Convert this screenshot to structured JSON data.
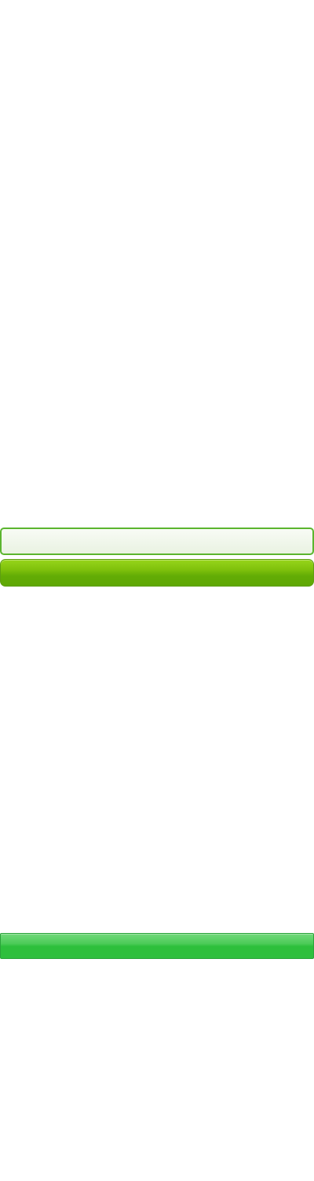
{
  "form": {
    "input_value": "",
    "input_placeholder": "",
    "submit_label": ""
  },
  "footer_bar": {
    "label": ""
  },
  "colors": {
    "input_border": "#5bb52f",
    "button_green": "#6fb80a",
    "bottom_bar_green": "#2dbf3b"
  }
}
